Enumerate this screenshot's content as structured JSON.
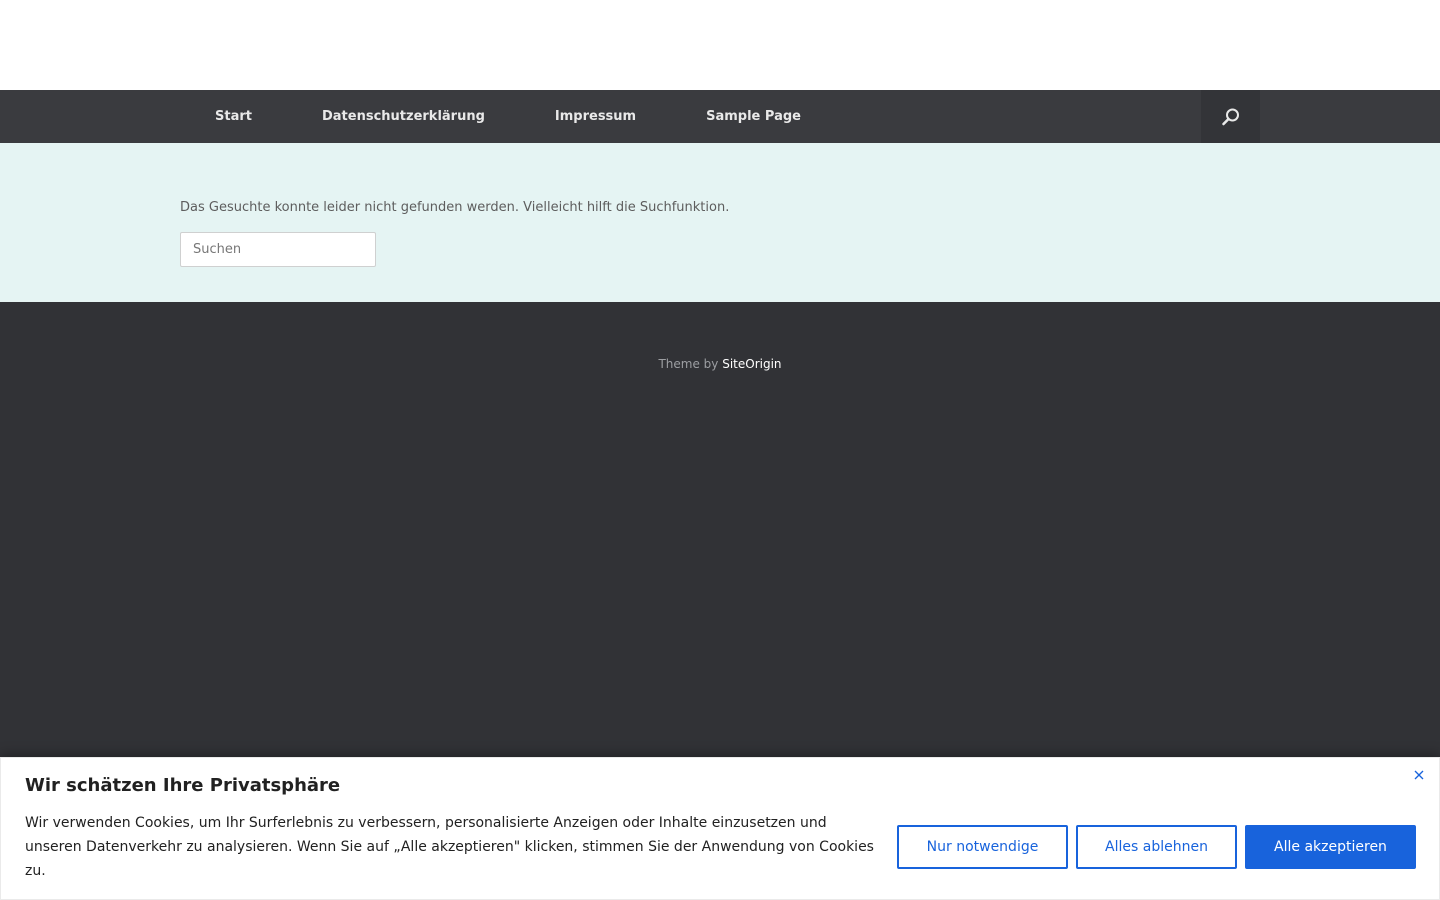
{
  "nav": {
    "items": [
      {
        "label": "Start"
      },
      {
        "label": "Datenschutzerklärung"
      },
      {
        "label": "Impressum"
      },
      {
        "label": "Sample Page"
      }
    ],
    "search_icon": "search-icon"
  },
  "main": {
    "not_found_text": "Das Gesuchte konnte leider nicht gefunden werden. Vielleicht hilft die Suchfunktion.",
    "search_placeholder": "Suchen"
  },
  "footer": {
    "credit_prefix": "Theme by",
    "credit_link": "SiteOrigin"
  },
  "cookie_banner": {
    "title": "Wir schätzen Ihre Privatsphäre",
    "text": "Wir verwenden Cookies, um Ihr Surferlebnis zu verbessern, personalisierte Anzeigen oder Inhalte einzusetzen und unseren Datenverkehr zu analysieren. Wenn Sie auf „Alle akzeptieren\" klicken, stimmen Sie der Anwendung von Cookies zu.",
    "buttons": {
      "necessary": "Nur notwendige",
      "reject": "Alles ablehnen",
      "accept": "Alle akzeptieren"
    },
    "close_icon": "close-icon"
  },
  "colors": {
    "nav_bg": "#3a3b3f",
    "content_bg": "#e5f4f3",
    "footer_bg": "#313236",
    "accent": "#1863dc"
  }
}
